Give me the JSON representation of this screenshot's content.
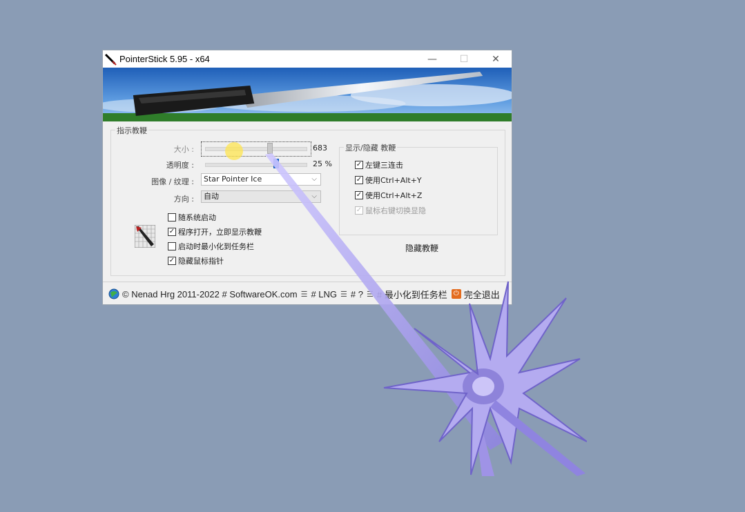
{
  "window": {
    "title": "PointerStick 5.95 - x64",
    "controls": {
      "minimize": "—",
      "maximize": "☐",
      "close": "✕"
    }
  },
  "main_group": {
    "title": "指示教鞭",
    "size": {
      "label": "大小 :",
      "value": "683"
    },
    "opacity": {
      "label": "透明度 :",
      "value": "25 %"
    },
    "image": {
      "label": "图像 / 纹理 :",
      "selected": "Star Pointer Ice"
    },
    "direction": {
      "label": "方向 :",
      "selected": "自动"
    },
    "options": [
      {
        "label": "随系统启动",
        "checked": false
      },
      {
        "label": "程序打开，立即显示教鞭",
        "checked": true
      },
      {
        "label": "启动时最小化到任务栏",
        "checked": false
      },
      {
        "label": "隐藏鼠标指针",
        "checked": true
      }
    ]
  },
  "show_hide_group": {
    "title": "显示/隐藏 教鞭",
    "options": [
      {
        "label": "左键三连击",
        "checked": true,
        "enabled": true
      },
      {
        "label": "使用Ctrl+Alt+Y",
        "checked": true,
        "enabled": true
      },
      {
        "label": "使用Ctrl+Alt+Z",
        "checked": true,
        "enabled": true
      },
      {
        "label": "鼠标右键切换显隐",
        "checked": true,
        "enabled": false
      }
    ],
    "hide_button": "隐藏教鞭"
  },
  "footer": {
    "copyright": "© Nenad Hrg 2011-2022 # SoftwareOK.com",
    "lng": "# LNG",
    "help": "# ?",
    "minimize_to_tray": "# 最小化到任务栏",
    "exit": "完全退出"
  },
  "colors": {
    "desktop": "#8a9cb5",
    "accent": "#1c6fe0",
    "pointer": "#9f93e6"
  }
}
